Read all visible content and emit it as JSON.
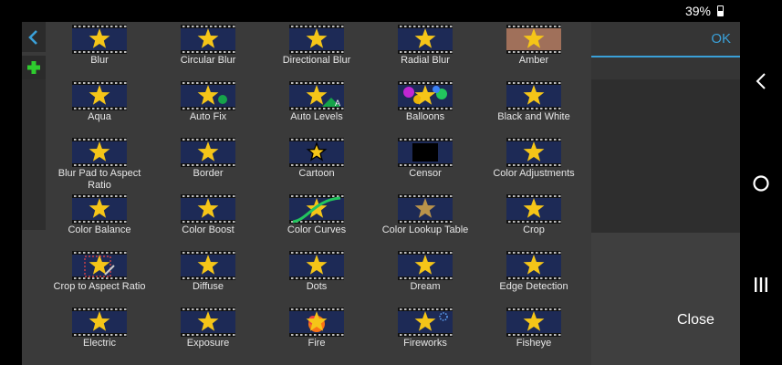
{
  "status_bar": {
    "battery": "39%"
  },
  "toolbar": {
    "ok_label": "OK",
    "close_label": "Close"
  },
  "icons": {
    "back": "chevron-left-icon",
    "add": "plus-icon",
    "nav_back": "chevron-left-icon",
    "nav_home": "circle-icon",
    "nav_recents": "three-bars-icon"
  },
  "colors": {
    "accent": "#3aa0d8",
    "add_green": "#2ecc2e",
    "star": "#f5c518",
    "panel": "#3a3a3a"
  },
  "effects": [
    {
      "label": "Blur",
      "variant": "plain"
    },
    {
      "label": "Circular Blur",
      "variant": "plain"
    },
    {
      "label": "Directional Blur",
      "variant": "plain"
    },
    {
      "label": "Radial Blur",
      "variant": "plain"
    },
    {
      "label": "Amber",
      "variant": "amber"
    },
    {
      "label": "Aqua",
      "variant": "plain"
    },
    {
      "label": "Auto Fix",
      "variant": "autofix"
    },
    {
      "label": "Auto Levels",
      "variant": "autolevels"
    },
    {
      "label": "Balloons",
      "variant": "balloons"
    },
    {
      "label": "Black and White",
      "variant": "plain"
    },
    {
      "label": "Blur Pad to Aspect Ratio",
      "variant": "plain"
    },
    {
      "label": "Border",
      "variant": "plain"
    },
    {
      "label": "Cartoon",
      "variant": "cartoon"
    },
    {
      "label": "Censor",
      "variant": "censor"
    },
    {
      "label": "Color Adjustments",
      "variant": "plain"
    },
    {
      "label": "Color Balance",
      "variant": "plain"
    },
    {
      "label": "Color Boost",
      "variant": "plain"
    },
    {
      "label": "Color Curves",
      "variant": "curves"
    },
    {
      "label": "Color Lookup Table",
      "variant": "lut"
    },
    {
      "label": "Crop",
      "variant": "plain"
    },
    {
      "label": "Crop to Aspect Ratio",
      "variant": "croparatio"
    },
    {
      "label": "Diffuse",
      "variant": "plain"
    },
    {
      "label": "Dots",
      "variant": "plain"
    },
    {
      "label": "Dream",
      "variant": "plain"
    },
    {
      "label": "Edge Detection",
      "variant": "plain"
    },
    {
      "label": "Electric",
      "variant": "plain"
    },
    {
      "label": "Exposure",
      "variant": "plain"
    },
    {
      "label": "Fire",
      "variant": "fire"
    },
    {
      "label": "Fireworks",
      "variant": "fireworks"
    },
    {
      "label": "Fisheye",
      "variant": "plain"
    }
  ]
}
